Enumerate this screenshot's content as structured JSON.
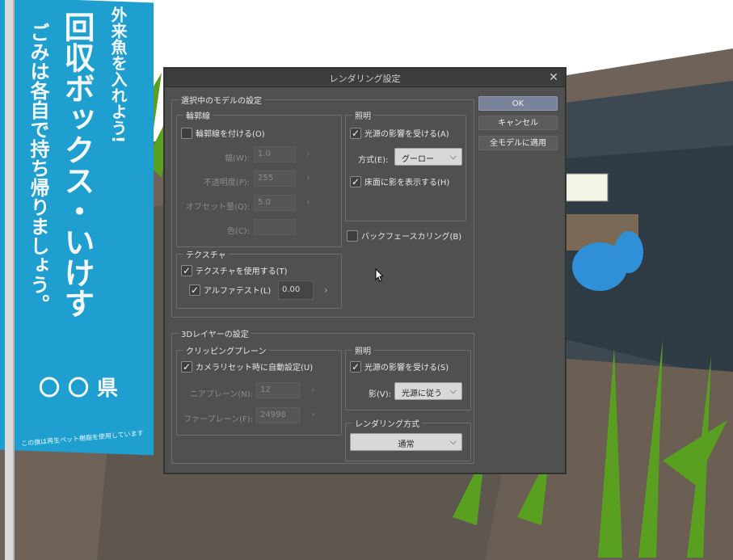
{
  "banner": {
    "line1": "外来魚を入れよう!",
    "line2": "回収ボックス・いけす",
    "line3": "ごみは各自で持ち帰りましょう。",
    "line4": "〇〇県",
    "small": "この旗は再生ペット樹脂を使用しています"
  },
  "dialog": {
    "title": "レンダリング設定",
    "buttons": {
      "ok": "OK",
      "cancel": "キャンセル",
      "apply_all": "全モデルに適用"
    },
    "model_section": {
      "label": "選択中のモデルの設定",
      "outline": {
        "label": "輪郭線",
        "enable": "輪郭線を付ける(O)",
        "width_label": "幅(W):",
        "width_value": "1.0",
        "opacity_label": "不透明度(P):",
        "opacity_value": "255",
        "offset_label": "オフセット量(Q):",
        "offset_value": "5.0",
        "color_label": "色(C):"
      },
      "lighting": {
        "label": "照明",
        "receive": "光源の影響を受ける(A)",
        "method_label": "方式(E):",
        "method_value": "グーロー",
        "floor_shadow": "床面に影を表示する(H)"
      },
      "backface": "バックフェースカリング(B)",
      "texture": {
        "label": "テクスチャ",
        "use": "テクスチャを使用する(T)",
        "alpha_test": "アルファテスト(L)",
        "alpha_value": "0.00"
      }
    },
    "layer_section": {
      "label": "3Dレイヤーの設定",
      "clipping": {
        "label": "クリッピングプレーン",
        "auto": "カメラリセット時に自動設定(U)",
        "near_label": "ニアプレーン(N):",
        "near_value": "12",
        "far_label": "ファープレーン(F):",
        "far_value": "24998"
      },
      "lighting": {
        "label": "照明",
        "receive": "光源の影響を受ける(S)",
        "shadow_label": "影(V):",
        "shadow_value": "光源に従う"
      },
      "render_method": {
        "label": "レンダリング方式",
        "value": "通常"
      }
    }
  }
}
